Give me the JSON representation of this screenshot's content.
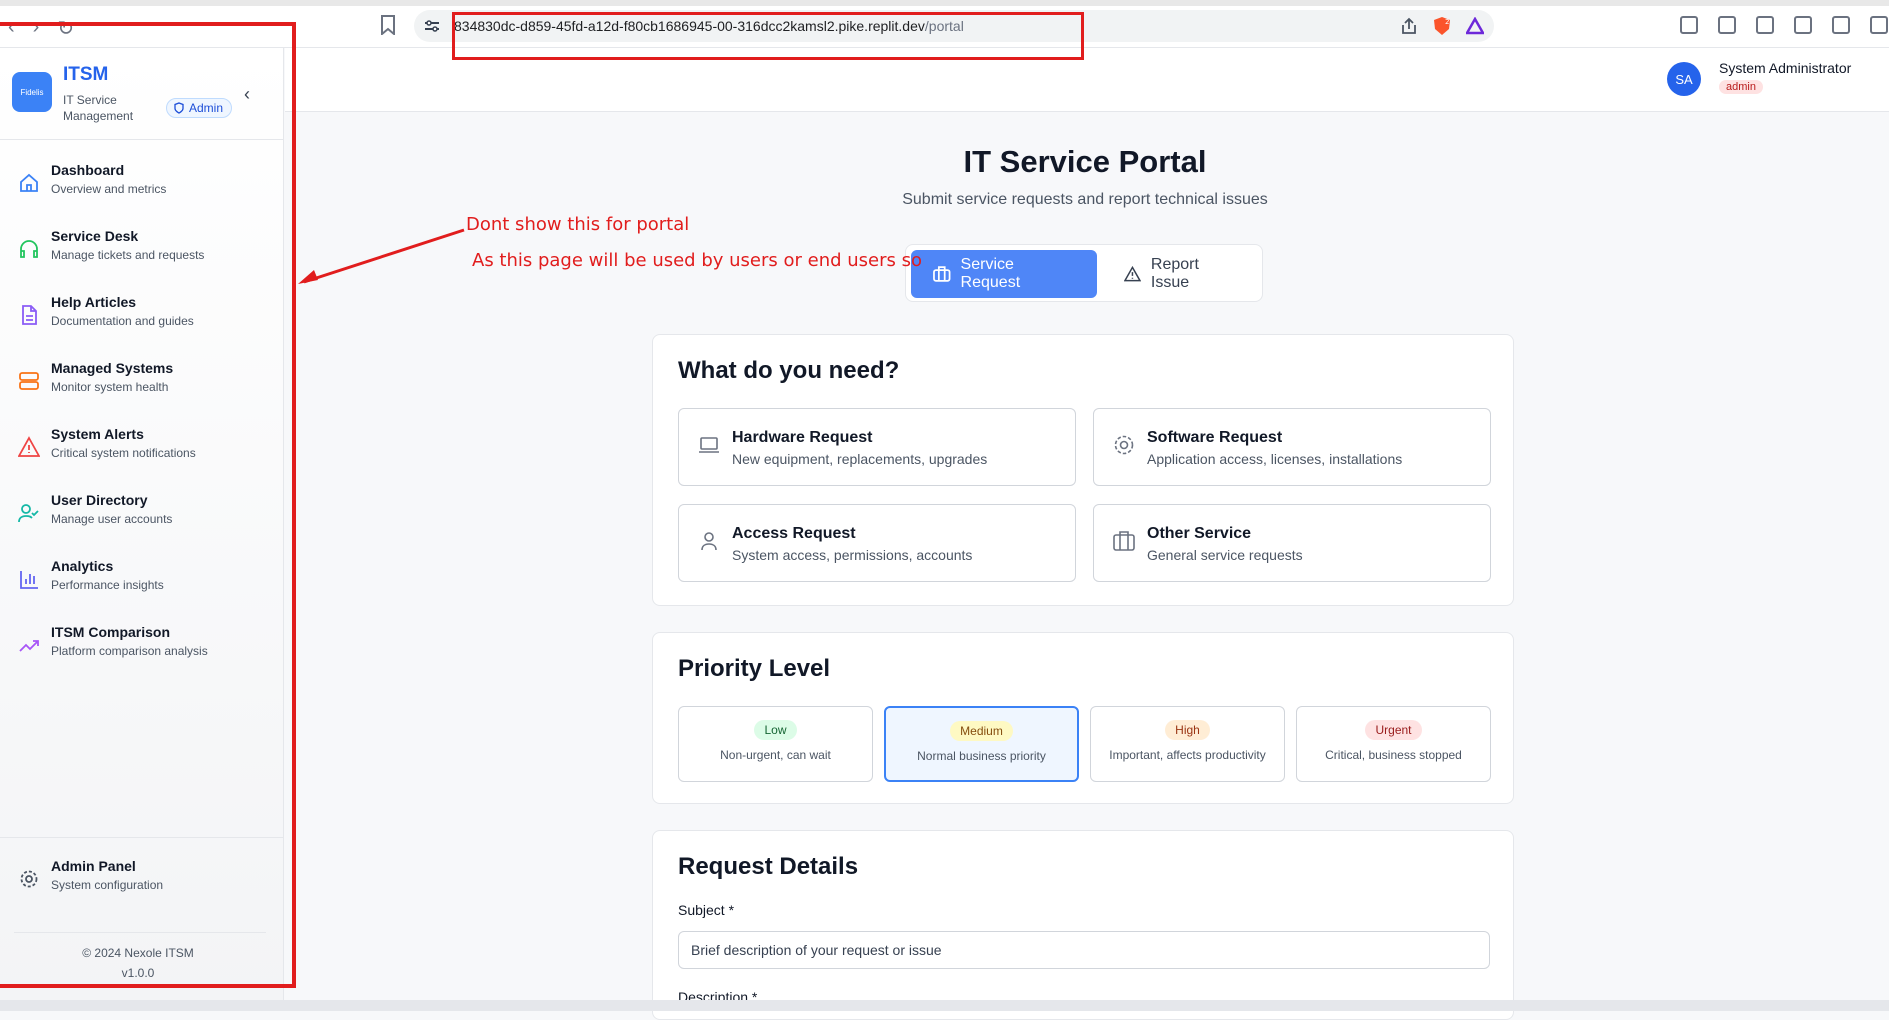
{
  "browser": {
    "url_host": "834830dc-d859-45fd-a12d-f80cb1686945-00-316dcc2kamsl2.pike.replit.dev",
    "url_path": "/portal",
    "shield_count": "2"
  },
  "sidebar": {
    "logo_text": "Fidelis",
    "title": "ITSM",
    "subtitle": "IT Service Management",
    "role_badge": "Admin",
    "items": [
      {
        "label": "Dashboard",
        "desc": "Overview and metrics",
        "icon": "home-icon",
        "color": "#3b82f6"
      },
      {
        "label": "Service Desk",
        "desc": "Manage tickets and requests",
        "icon": "headset-icon",
        "color": "#22c55e"
      },
      {
        "label": "Help Articles",
        "desc": "Documentation and guides",
        "icon": "document-icon",
        "color": "#8b5cf6"
      },
      {
        "label": "Managed Systems",
        "desc": "Monitor system health",
        "icon": "server-icon",
        "color": "#f97316"
      },
      {
        "label": "System Alerts",
        "desc": "Critical system notifications",
        "icon": "alert-triangle-icon",
        "color": "#ef4444"
      },
      {
        "label": "User Directory",
        "desc": "Manage user accounts",
        "icon": "user-check-icon",
        "color": "#14b8a6"
      },
      {
        "label": "Analytics",
        "desc": "Performance insights",
        "icon": "bar-chart-icon",
        "color": "#6366f1"
      },
      {
        "label": "ITSM Comparison",
        "desc": "Platform comparison analysis",
        "icon": "trending-up-icon",
        "color": "#a855f7"
      }
    ],
    "admin": {
      "label": "Admin Panel",
      "desc": "System configuration"
    },
    "copyright": "© 2024 Nexole ITSM",
    "version": "v1.0.0"
  },
  "header": {
    "avatar": "SA",
    "username": "System Administrator",
    "role": "admin"
  },
  "portal": {
    "title": "IT Service Portal",
    "subtitle": "Submit service requests and report technical issues",
    "tab_request": "Service Request",
    "tab_issue": "Report Issue",
    "need_title": "What do you need?",
    "options": [
      {
        "title": "Hardware Request",
        "desc": "New equipment, replacements, upgrades",
        "icon": "laptop-icon"
      },
      {
        "title": "Software Request",
        "desc": "Application access, licenses, installations",
        "icon": "gear-icon"
      },
      {
        "title": "Access Request",
        "desc": "System access, permissions, accounts",
        "icon": "user-icon"
      },
      {
        "title": "Other Service",
        "desc": "General service requests",
        "icon": "briefcase-icon"
      }
    ],
    "priority_title": "Priority Level",
    "priorities": [
      {
        "label": "Low",
        "desc": "Non-urgent, can wait",
        "bg": "#dcfce7",
        "fg": "#166534"
      },
      {
        "label": "Medium",
        "desc": "Normal business priority",
        "bg": "#fef9c3",
        "fg": "#854d0e",
        "selected": true
      },
      {
        "label": "High",
        "desc": "Important, affects productivity",
        "bg": "#ffedd5",
        "fg": "#9a3412"
      },
      {
        "label": "Urgent",
        "desc": "Critical, business stopped",
        "bg": "#fee2e2",
        "fg": "#991b1b"
      }
    ],
    "details_title": "Request Details",
    "subject_label": "Subject *",
    "subject_value": "Brief description of your request or issue",
    "description_label": "Description *"
  },
  "annotations": {
    "note1": "Dont show this for portal",
    "note2": "As this page will be used by users or end users so",
    "color": "#e11d1d"
  }
}
